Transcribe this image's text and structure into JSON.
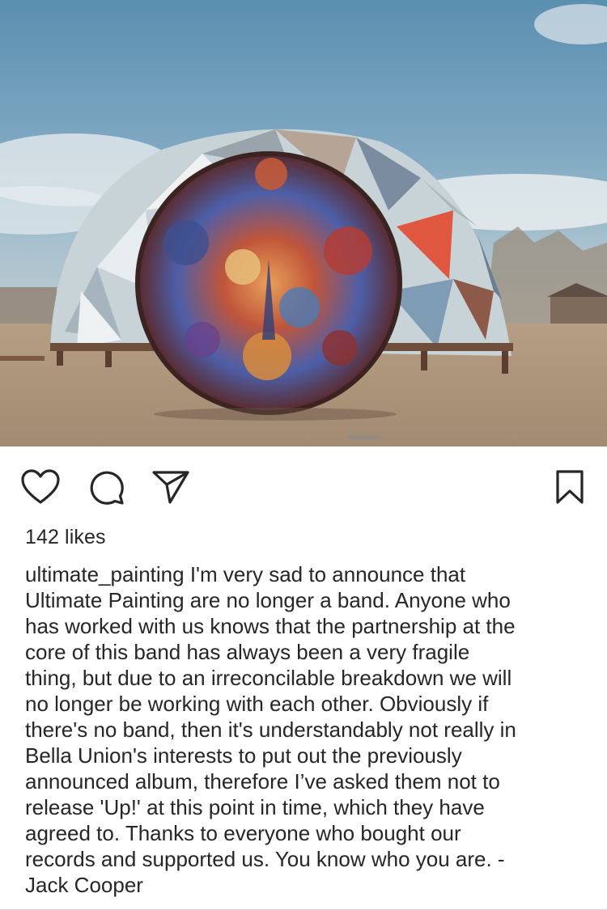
{
  "post": {
    "image": {
      "description_icon": "dome-photo"
    },
    "actions": {
      "like_icon": "heart-icon",
      "comment_icon": "comment-icon",
      "share_icon": "paper-plane-icon",
      "save_icon": "bookmark-icon"
    },
    "likes_text": "142 likes",
    "caption": {
      "username": "ultimate_painting",
      "lines": [
        "I'm very sad to announce that",
        "Ultimate Painting are no longer a band. Anyone who",
        "has worked with us knows that the partnership at the",
        "core of this band has always been a very fragile",
        "thing, but due to an irreconcilable breakdown we will",
        "no longer be working with each other. Obviously if",
        "there's no band, then it's understandably not really in",
        "Bella Union's interests to put out the previously",
        "announced album, therefore I’ve asked them not to",
        "release 'Up!' at this point in time, which they have",
        "agreed to. Thanks to everyone who bought our",
        "records and supported us. You know who you are. -",
        "Jack Cooper"
      ]
    },
    "colors": {
      "text": "#262626",
      "divider": "#dbdbdb"
    }
  }
}
